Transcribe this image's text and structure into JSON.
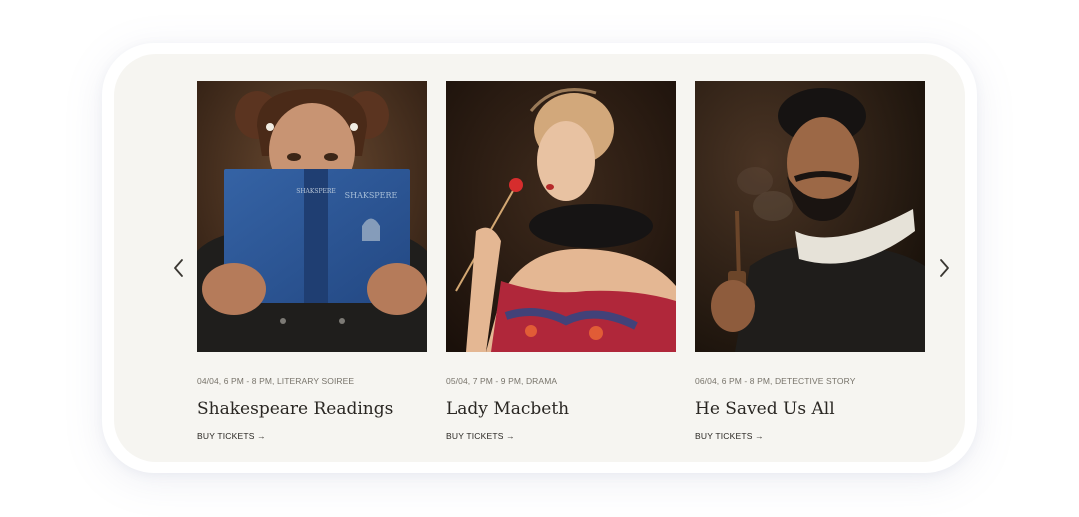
{
  "carousel": {
    "prev_icon": "chevron-left-icon",
    "next_icon": "chevron-right-icon",
    "events": [
      {
        "meta": "04/04, 6 PM - 8 PM, Literary Soiree",
        "title": "Shakespeare Readings",
        "cta": "Buy Tickets →",
        "book_spine_text": "SHAKSPERE",
        "book_cover_text": "SHAKSPERE"
      },
      {
        "meta": "05/04, 7 PM - 9 PM, Drama",
        "title": "Lady Macbeth",
        "cta": "Buy Tickets →"
      },
      {
        "meta": "06/04, 6 PM - 8 PM, Detective Story",
        "title": "He Saved Us All",
        "cta": "Buy Tickets →"
      }
    ]
  },
  "colors": {
    "panel_bg": "#f6f5f1",
    "text_dark": "#2a2723",
    "text_muted": "#77736a"
  }
}
